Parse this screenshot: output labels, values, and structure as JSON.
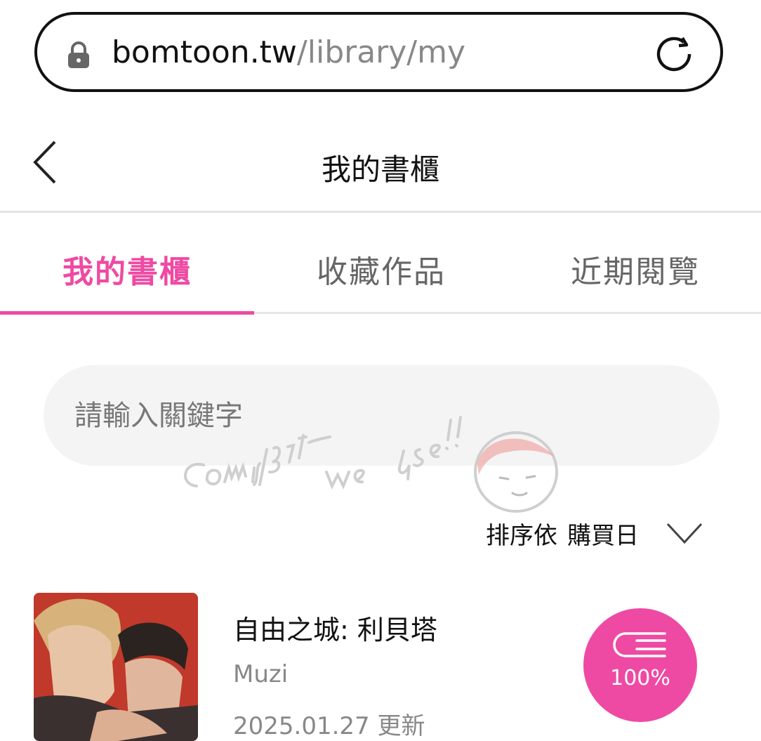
{
  "browser": {
    "url_domain": "bomtoon.tw",
    "url_path": "/library/my"
  },
  "header": {
    "title": "我的書櫃"
  },
  "tabs": [
    {
      "label": "我的書櫃",
      "active": true
    },
    {
      "label": "收藏作品",
      "active": false
    },
    {
      "label": "近期閱覽",
      "active": false
    }
  ],
  "search": {
    "placeholder": "請輸入關鍵字"
  },
  "sort": {
    "label": "排序依",
    "value": "購買日"
  },
  "books": [
    {
      "title": "自由之城: 利貝塔",
      "author": "Muzi",
      "updated": "2025.01.27 更新",
      "progress": "100%"
    }
  ],
  "colors": {
    "accent": "#ee4aa3",
    "tab_inactive": "#666666",
    "search_bg": "#f4f4f4",
    "cover_bg": "#c0392b"
  },
  "icons": [
    "lock-icon",
    "reload-icon",
    "back-arrow-icon",
    "chevron-down-icon",
    "book-icon"
  ],
  "watermark_text": "Commission we use!!"
}
